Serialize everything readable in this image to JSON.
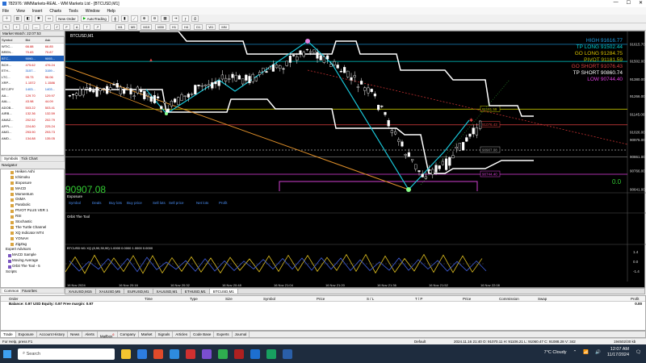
{
  "window": {
    "title": "782976: WMMarkets-REAL - WM Markets Ltd - [BTCUSD,M1]"
  },
  "menu": [
    "File",
    "View",
    "Insert",
    "Charts",
    "Tools",
    "Window",
    "Help"
  ],
  "toolbar": {
    "new_order": "New Order",
    "autotrading": "AutoTrading"
  },
  "timeframes": [
    "M1",
    "M5",
    "M15",
    "M30",
    "H1",
    "H4",
    "D1",
    "W1",
    "MN"
  ],
  "market_watch": {
    "title": "Market Watch: 22:07:53",
    "headers": [
      "Symbol",
      "Bid",
      "Ask"
    ],
    "rows": [
      {
        "s": "WTIC...",
        "b": "66.88",
        "a": "66.85",
        "c": "red"
      },
      {
        "s": "BREN...",
        "b": "70.83",
        "a": "70.87",
        "c": "red"
      },
      {
        "s": "BTC...",
        "b": "9090...",
        "a": "9093...",
        "c": "sel"
      },
      {
        "s": "BCH...",
        "b": "475.62",
        "a": "476.24",
        "c": "red"
      },
      {
        "s": "ETH...",
        "b": "3157...",
        "a": "3159...",
        "c": "blue"
      },
      {
        "s": "LTC...",
        "b": "95.73",
        "a": "96.06",
        "c": "red"
      },
      {
        "s": "XRP...",
        "b": "1.1572",
        "a": "1.1586",
        "c": "red"
      },
      {
        "s": "BTCJPY",
        "b": "1403...",
        "a": "1403...",
        "c": "blue"
      },
      {
        "s": "AA...",
        "b": "129.70",
        "a": "129.97",
        "c": "red"
      },
      {
        "s": "AAL...",
        "b": "43.98",
        "a": "44.09",
        "c": "red"
      },
      {
        "s": "ADOB...",
        "b": "503.22",
        "a": "503.41",
        "c": "red"
      },
      {
        "s": "AIRB...",
        "b": "132.36",
        "a": "132.59",
        "c": "red"
      },
      {
        "s": "AMAZ...",
        "b": "202.52",
        "a": "202.79",
        "c": "red"
      },
      {
        "s": "APPL...",
        "b": "224.80",
        "a": "225.24",
        "c": "red"
      },
      {
        "s": "AMG...",
        "b": "293.90",
        "a": "293.73",
        "c": "red"
      },
      {
        "s": "AMD...",
        "b": "134.88",
        "a": "135.05",
        "c": "red"
      }
    ],
    "tabs": [
      "Symbols",
      "Tick Chart"
    ]
  },
  "navigator": {
    "title": "Navigator",
    "indicators": [
      "Heiken Ashi",
      "Ichimoku",
      "iExposure",
      "MACD",
      "Momentum",
      "OsMA",
      "Parabolic",
      "PIVOT PLUS VER 1",
      "RSI",
      "Stochastic",
      "The Turtle Channel",
      "XQ Indicator MT4",
      "YONAH",
      "ZigZag"
    ],
    "ea_group": "Expert Advisors",
    "eas": [
      "MACD Sample",
      "Moving Average",
      "Orbit The Tool - 5"
    ],
    "scripts": "Scripts",
    "tabs": [
      "Common",
      "Favorites"
    ]
  },
  "chart": {
    "symbol": "BTCUSD,M1",
    "big_price": "90907.08",
    "right_zero": "0.0",
    "levels": [
      {
        "label": "HIGH",
        "value": "91616.77",
        "color": "#1ea0e6"
      },
      {
        "label": "TP LONG",
        "value": "91502.44",
        "color": "#00d0d0"
      },
      {
        "label": "GO LONG",
        "value": "91284.75",
        "color": "#d8c000"
      },
      {
        "label": "PIVOT",
        "value": "91181.59",
        "color": "#c0c000"
      },
      {
        "label": "GO SHORT",
        "value": "91076.43",
        "color": "#e04040"
      },
      {
        "label": "TP SHORT",
        "value": "90860.74",
        "color": "#ffffff"
      },
      {
        "label": "LOW",
        "value": "90744.40",
        "color": "#e040e0"
      }
    ],
    "line_tags": [
      "91181.59",
      "91076.43",
      "90907.08",
      "90744.40"
    ],
    "y_ticks": [
      "91615.70",
      "91502.00",
      "91380.00",
      "91266.00",
      "91145.00",
      "91026.00",
      "90975.00",
      "90861.00",
      "90766.00",
      "90641.00"
    ],
    "exposure": {
      "title": "Exposure",
      "cols": [
        "Symbol",
        "Deals",
        "Buy lots",
        "Buy price",
        "Sell lots",
        "Sell price",
        "Net lots",
        "Profit"
      ]
    },
    "orbit": "Orbit The Tool",
    "osc_title": "BTCUSD M1 XQ (8,90,30,90) 1.0000 0.0000 1.0000 0.0000",
    "osc_ticks": [
      "1.4",
      "0.0",
      "-1.4"
    ],
    "x_ticks": [
      "16 Nov 2024",
      "16 Nov 20:16",
      "16 Nov 20:32",
      "16 Nov 20:48",
      "16 Nov 21:04",
      "16 Nov 21:20",
      "16 Nov 21:36",
      "16 Nov 21:52",
      "16 Nov 22:08"
    ]
  },
  "chart_tabs": [
    "XAUUSD,M15",
    "XAUUSD,M5",
    "EURUSD,M1",
    "XAUUSD,M1",
    "ETHUSD,M1",
    "BTCUSD,M1"
  ],
  "terminal": {
    "headers": [
      "Order",
      "Time",
      "Type",
      "Size",
      "Symbol",
      "Price",
      "S / L",
      "T / P",
      "Price",
      "Commission",
      "Swap",
      "Profit"
    ],
    "balance": "Balance: 0.97 USD  Equity: 0.97  Free margin: 0.97",
    "profit": "0.00",
    "tabs": [
      "Trade",
      "Exposure",
      "Account History",
      "News",
      "Alerts",
      "Mailbox",
      "Company",
      "Market",
      "Signals",
      "Articles",
      "Code Base",
      "Experts",
      "Journal"
    ],
    "mailbox_badge": "6"
  },
  "status": {
    "help": "For Help, press F1",
    "profile": "Default",
    "ohlc": "2024.11.16 21:40   O: 91070.11   H: 91106.21   L: 91060.47   C: 91088.28   V: 342",
    "traffic": "194502/30 kb"
  },
  "taskbar": {
    "search": "Search",
    "weather": "7°C  Cloudy",
    "time": "12:07 AM",
    "date": "11/17/2024"
  }
}
